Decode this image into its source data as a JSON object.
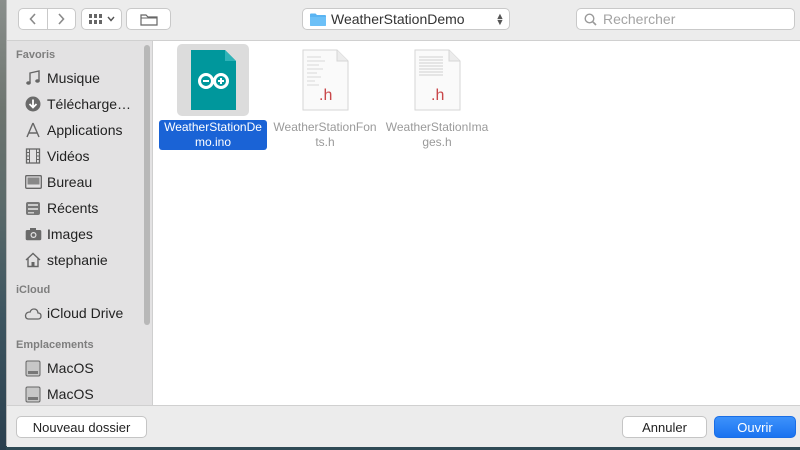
{
  "toolbar": {
    "back_icon": "chevron-left-icon",
    "forward_icon": "chevron-right-icon",
    "view_icon": "grid-view-icon",
    "new_folder_icon": "folder-icon",
    "current_folder": "WeatherStationDemo",
    "search_placeholder": "Rechercher"
  },
  "sidebar": {
    "sections": {
      "favorites": "Favoris",
      "icloud": "iCloud",
      "locations": "Emplacements"
    },
    "favorites": [
      {
        "label": "Musique",
        "icon": "music-note-icon"
      },
      {
        "label": "Télécharge…",
        "icon": "download-icon"
      },
      {
        "label": "Applications",
        "icon": "applications-icon"
      },
      {
        "label": "Vidéos",
        "icon": "film-icon"
      },
      {
        "label": "Bureau",
        "icon": "desktop-icon"
      },
      {
        "label": "Récents",
        "icon": "recents-icon"
      },
      {
        "label": "Images",
        "icon": "camera-icon"
      },
      {
        "label": "stephanie",
        "icon": "home-icon"
      }
    ],
    "icloud": [
      {
        "label": "iCloud Drive",
        "icon": "cloud-icon"
      }
    ],
    "locations": [
      {
        "label": "MacOS",
        "icon": "disk-icon"
      },
      {
        "label": "MacOS",
        "icon": "disk-icon"
      }
    ]
  },
  "files": [
    {
      "name": "WeatherStationDemo.ino",
      "selected": true,
      "icon": "arduino-file-icon"
    },
    {
      "name": "WeatherStationFonts.h",
      "selected": false,
      "icon": "header-file-icon",
      "ext": ".h"
    },
    {
      "name": "WeatherStationImages.h",
      "selected": false,
      "icon": "header-file-icon",
      "ext": ".h"
    }
  ],
  "buttons": {
    "new_folder": "Nouveau dossier",
    "cancel": "Annuler",
    "open": "Ouvrir"
  },
  "colors": {
    "selection": "#1a63d6",
    "arduino_teal": "#00979c",
    "primary_button": "#1a73f0"
  }
}
